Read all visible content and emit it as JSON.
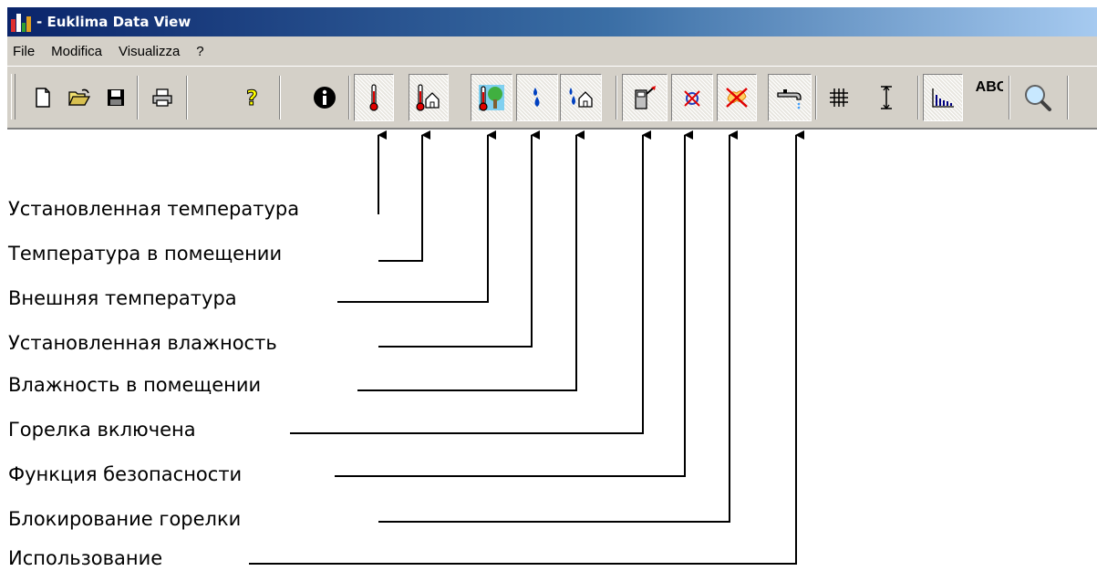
{
  "window": {
    "title": "- Euklima Data View",
    "app_icon": "bar-chart-app-icon"
  },
  "menu": {
    "items": [
      "File",
      "Modifica",
      "Visualizza",
      "?"
    ]
  },
  "toolbar": {
    "buttons": [
      {
        "name": "new-document",
        "icon": "new-document-icon"
      },
      {
        "name": "open-folder",
        "icon": "open-folder-icon"
      },
      {
        "name": "save",
        "icon": "floppy-disk-icon"
      },
      {
        "name": "print",
        "icon": "printer-icon"
      },
      {
        "name": "help",
        "icon": "question-mark-icon"
      },
      {
        "name": "info",
        "icon": "info-icon"
      },
      {
        "name": "set-temperature",
        "icon": "thermometer-icon"
      },
      {
        "name": "room-temperature",
        "icon": "thermometer-house-icon"
      },
      {
        "name": "outdoor-temperature",
        "icon": "thermometer-tree-icon"
      },
      {
        "name": "set-humidity",
        "icon": "water-drops-icon"
      },
      {
        "name": "room-humidity",
        "icon": "water-drops-house-icon"
      },
      {
        "name": "burner-on",
        "icon": "burner-on-icon"
      },
      {
        "name": "safety-function",
        "icon": "safety-cross-icon"
      },
      {
        "name": "burner-lock",
        "icon": "burner-lock-icon"
      },
      {
        "name": "usage",
        "icon": "tap-icon"
      },
      {
        "name": "grid",
        "icon": "grid-icon"
      },
      {
        "name": "vertical-scale",
        "icon": "vertical-scale-icon"
      },
      {
        "name": "bar-chart",
        "icon": "bar-chart-icon"
      },
      {
        "name": "labels",
        "icon": "abc-text-icon",
        "text": "ABC"
      },
      {
        "name": "zoom",
        "icon": "magnifier-icon"
      }
    ]
  },
  "annotations": [
    {
      "label": "Установленная температура"
    },
    {
      "label": "Температура в помещении"
    },
    {
      "label": "Внешняя температура"
    },
    {
      "label": "Установленная влажность"
    },
    {
      "label": "Влажность в помещении"
    },
    {
      "label": "Горелка включена"
    },
    {
      "label": "Функция безопасности"
    },
    {
      "label": "Блокирование горелки"
    },
    {
      "label": "Использование"
    }
  ]
}
